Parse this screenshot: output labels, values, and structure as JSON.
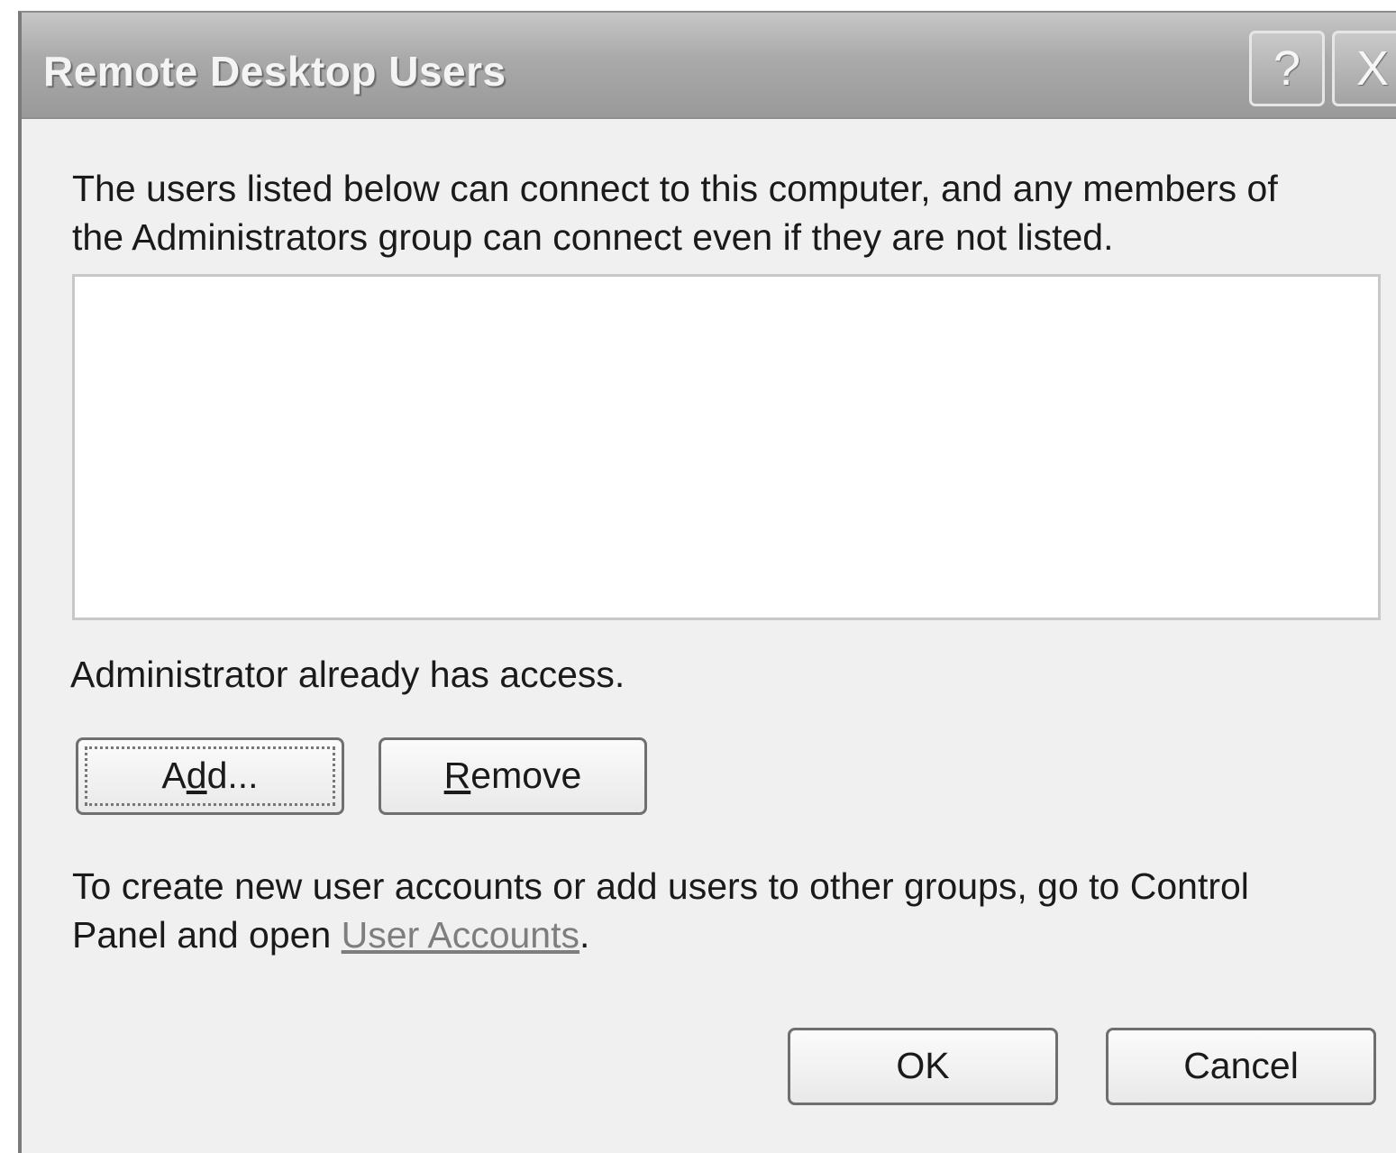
{
  "window": {
    "title": "Remote Desktop Users",
    "help_label": "?",
    "close_label": "X"
  },
  "intro": {
    "line1": "The users listed below can connect to this computer, and any members of",
    "line2": "the Administrators group can connect even if they are not listed."
  },
  "user_list": {
    "items": []
  },
  "status_text": "Administrator already has access.",
  "buttons": {
    "add": {
      "before": "A",
      "mnemonic": "d",
      "after": "d..."
    },
    "remove": {
      "mnemonic": "R",
      "after": "emove"
    },
    "ok": "OK",
    "cancel": "Cancel"
  },
  "footer": {
    "line1": "To create new user accounts or add users to other groups, go to Control",
    "line2_prefix": "Panel and open ",
    "link_text": "User Accounts",
    "line2_suffix": "."
  }
}
